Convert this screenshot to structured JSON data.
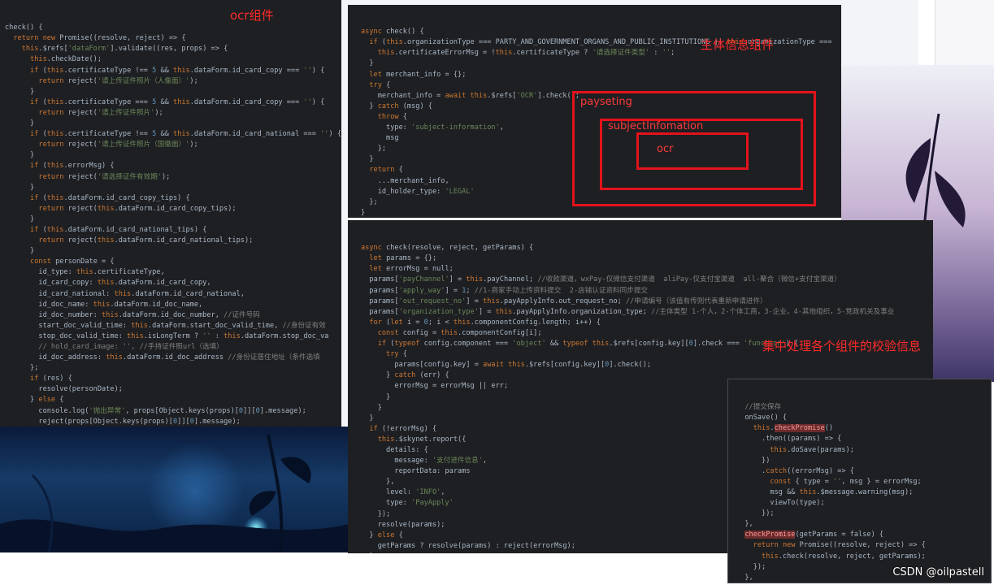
{
  "captions": {
    "ocr": "ocr组件",
    "subject": "主体信息组件",
    "centralized": "集中处理各个组件的校验信息"
  },
  "diagram": {
    "outer": "payseting",
    "middle": "subjectInfomation",
    "inner": "ocr"
  },
  "watermark": "CSDN @oilpastell",
  "panels": {
    "ocr_check": [
      "check() {",
      "  return new Promise((resolve, reject) => {",
      "    this.$refs['dataForm'].validate((res, props) => {",
      "      this.checkDate();",
      "      if (this.certificateType !== 5 && this.dataForm.id_card_copy === '') {",
      "        return reject('请上传证件照片（人像面）');",
      "      }",
      "      if (this.certificateType === 5 && this.dataForm.id_card_copy === '') {",
      "        return reject('请上传证件照片');",
      "      }",
      "      if (this.certificateType !== 5 && this.dataForm.id_card_national === '') {",
      "        return reject('请上传证件照片（国徽面）');",
      "      }",
      "      if (this.errorMsg) {",
      "        return reject('请选择证件有效期');",
      "      }",
      "      if (this.dataForm.id_card_copy_tips) {",
      "        return reject(this.dataForm.id_card_copy_tips);",
      "      }",
      "      if (this.dataForm.id_card_national_tips) {",
      "        return reject(this.dataForm.id_card_national_tips);",
      "      }",
      "      const personDate = {",
      "        id_type: this.certificateType,",
      "        id_card_copy: this.dataForm.id_card_copy,",
      "        id_card_national: this.dataForm.id_card_national,",
      "        id_doc_name: this.dataForm.id_doc_name,",
      "        id_doc_number: this.dataForm.id_doc_number, //证件号码",
      "        start_doc_valid_time: this.dataForm.start_doc_valid_time, //身份证有效",
      "        stop_doc_valid_time: this.isLongTerm ? '' : this.dataForm.stop_doc_va",
      "        // hold_card_image: '', //手持证件照url（选填）",
      "        id_doc_address: this.dataForm.id_doc_address //身份证居住地址（条件选填",
      "      };",
      "      if (res) {",
      "        resolve(personDate);",
      "      } else {",
      "        console.log('抛出异常', props[Object.keys(props)[0]][0].message);",
      "        reject(props[Object.keys(props)[0]][0].message);",
      "      }",
      "    });"
    ],
    "subject_check": [
      "async check() {",
      "  if (this.organizationType === PARTY_AND_GOVERNMENT_ORGANS_AND_PUBLIC_INSTITUTIONS || this.organizationType ===",
      "    this.certificateErrorMsg = !this.certificateType ? '请选择证件类型' : '';",
      "  }",
      "  let merchant_info = {};",
      "  try {",
      "    merchant_info = await this.$refs['OCR'].check();",
      "  } catch (msg) {",
      "    throw {",
      "      type: 'subject-information',",
      "      msg",
      "    };",
      "  }",
      "  return {",
      "    ...merchant_info,",
      "    id_holder_type: 'LEGAL'",
      "  };",
      "}"
    ],
    "pay_check": [
      "async check(resolve, reject, getParams) {",
      "  let params = {};",
      "  let errorMsg = null;",
      "  params['payChannel'] = this.payChannel; //收款渠道，wxPay-仅微信支付渠道  aliPay-仅支付宝渠道  all-聚合（微信+支付宝渠道）",
      "  params['apply_way'] = 1; //1-商家手动上传资料提交  2-店铺认证资料同步提交",
      "  params['out_request_no'] = this.payApplyInfo.out_request_no; //申请编号（该值有传则代表重新申请进件）",
      "  params['organization_type'] = this.payApplyInfo.organization_type; //主体类型 1-个人，2-个体工商，3-企业，4-其他组织，5-党政机关及事业",
      "  for (let i = 0; i < this.componentConfig.length; i++) {",
      "    const config = this.componentConfig[i];",
      "    if (typeof config.component === 'object' && typeof this.$refs[config.key][0].check === 'function') {",
      "      try {",
      "        params[config.key] = await this.$refs[config.key][0].check();",
      "      } catch (err) {",
      "        errorMsg = errorMsg || err;",
      "      }",
      "    }",
      "  }",
      "  if (!errorMsg) {",
      "    this.$skynet.report({",
      "      details: {",
      "        message: '支付进件信息',",
      "        reportData: params",
      "      },",
      "      level: 'INFO',",
      "      type: 'PayApply'",
      "    });",
      "    resolve(params);",
      "  } else {",
      "    getParams ? resolve(params) : reject(errorMsg);",
      "  }",
      "},"
    ],
    "save": [
      "  //提交保存",
      "  onSave() {",
      "    this.checkPromise()",
      "      .then((params) => {",
      "        this.doSave(params);",
      "      })",
      "      .catch((errorMsg) => {",
      "        const { type = '', msg } = errorMsg;",
      "        msg && this.$message.warning(msg);",
      "        viewTo(type);",
      "      });",
      "  },",
      "  checkPromise(getParams = false) {",
      "    return new Promise((resolve, reject) => {",
      "      this.check(resolve, reject, getParams);",
      "    });",
      "  },"
    ]
  }
}
